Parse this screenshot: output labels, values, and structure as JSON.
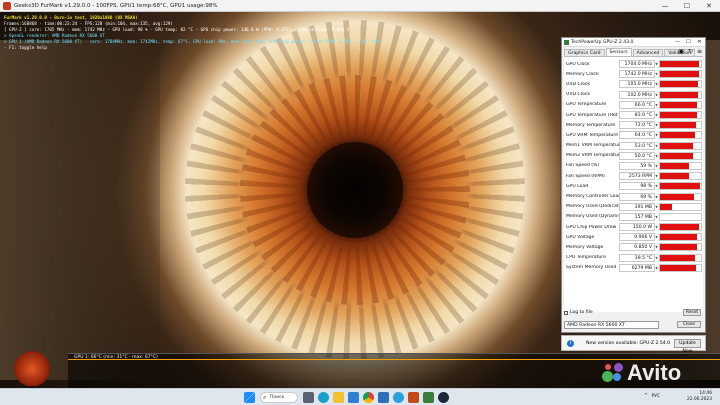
{
  "furmark": {
    "title": "Geeks3D FurMark v1.29.0.0 - 100FPS, GPU1 temp:68°C, GPU1 usage:98%",
    "overlay_lines": [
      {
        "text": "FurMark v1.29.0.0 - Burn-in test, 1920x1080 (0X MSAA)",
        "style": "yellow"
      },
      {
        "text": "Frames:168868 - time:00:23:24 - FPS:128 (min:104, max:135, avg:129)",
        "style": "white"
      },
      {
        "text": "[ GPU-Z ] core: 1705 MHz - mem: 1742 MHz - GPU load: 98 % - GPU temp: 82 °C - GPU chip power: 146.8 W (PPW: 0.871) - GPU voltage: 0.906 V",
        "style": "white"
      },
      {
        "text": "> OpenGL renderer: AMD Radeon RX 5600 XT",
        "style": "cyan"
      },
      {
        "text": "> GPU 1 (AMD Radeon RX 5600 XT) - core: 1704MHz, mem: 1742MHz, temp: 67°C, GPU load: 98%, mem load: 64%, GPU chip power: 148 W (PPW: 0.865), fan: 59%",
        "style": "cyan"
      },
      {
        "text": "- F1: toggle help",
        "style": "white"
      }
    ],
    "graph_label": "GPU 1: 66°C (min: 31°C - max: 67°C)",
    "window_controls": [
      "—",
      "☐",
      "✕"
    ]
  },
  "gpuz": {
    "title": "TechPowerUp GPU-Z 2.43.0",
    "title_controls": [
      "—",
      "☐",
      "✕"
    ],
    "tabs": [
      "Graphics Card",
      "Sensors",
      "Advanced",
      "Validation"
    ],
    "active_tab": "Sensors",
    "sensors": [
      {
        "name": "GPU Clock",
        "value": "1704.0 MHz",
        "fill": 0.95
      },
      {
        "name": "Memory Clock",
        "value": "1742.0 MHz",
        "fill": 0.95
      },
      {
        "name": "UVD Clock",
        "value": "105.0 MHz",
        "fill": 0.92
      },
      {
        "name": "UVD Clock",
        "value": "102.0 MHz",
        "fill": 0.92
      },
      {
        "name": "GPU Temperature",
        "value": "66.0 °C",
        "fill": 0.9
      },
      {
        "name": "GPU Temperature (Hot Spot)",
        "value": "83.0 °C",
        "fill": 0.9
      },
      {
        "name": "Memory Temperature",
        "value": "72.0 °C",
        "fill": 0.88
      },
      {
        "name": "GPU VRM Temperature",
        "value": "64.0 °C",
        "fill": 0.85
      },
      {
        "name": "Mem1 VRM Temperature",
        "value": "53.0 °C",
        "fill": 0.8
      },
      {
        "name": "Mem2 VRM Temperature",
        "value": "50.0 °C",
        "fill": 0.8
      },
      {
        "name": "Fan Speed (%)",
        "value": "59 %",
        "fill": 0.7
      },
      {
        "name": "Fan Speed (RPM)",
        "value": "2573 RPM",
        "fill": 0.7
      },
      {
        "name": "GPU Load",
        "value": "98 %",
        "fill": 0.98
      },
      {
        "name": "Memory Controller Load",
        "value": "69 %",
        "fill": 0.82
      },
      {
        "name": "Memory Used (Dedicated)",
        "value": "391 MB",
        "fill": 0.3
      },
      {
        "name": "Memory Used (Dynamic)",
        "value": "157 MB",
        "fill": 0.0
      },
      {
        "name": "GPU Chip Power Draw",
        "value": "150.0 W",
        "fill": 0.95
      },
      {
        "name": "GPU Voltage",
        "value": "0.906 V",
        "fill": 0.9
      },
      {
        "name": "Memory Voltage",
        "value": "0.850 V",
        "fill": 0.9
      },
      {
        "name": "CPU Temperature",
        "value": "39.5 °C",
        "fill": 0.85
      },
      {
        "name": "System Memory Used",
        "value": "6279 MB",
        "fill": 0.88
      }
    ],
    "log_to_file": "Log to file",
    "reset_label": "Reset",
    "gpu_select": "AMD Radeon RX 5600 XT",
    "close_label": "Close",
    "update_message": "New version available: GPU-Z 2.54.0",
    "update_button": "Update Now",
    "colors": {
      "graph_fill": "#e11010"
    }
  },
  "taskbar": {
    "search_label": "Поиск",
    "language": "РУС",
    "time": "14:46",
    "date": "22.06.2023",
    "apps": [
      "start-icon",
      "search-icon",
      "task-view-icon",
      "edge-icon",
      "file-explorer-icon",
      "store-icon",
      "chrome-icon",
      "mail-icon",
      "telegram-icon",
      "furmark-icon",
      "gpuz-icon",
      "steam-icon"
    ]
  },
  "watermark": {
    "text": "Avito"
  }
}
